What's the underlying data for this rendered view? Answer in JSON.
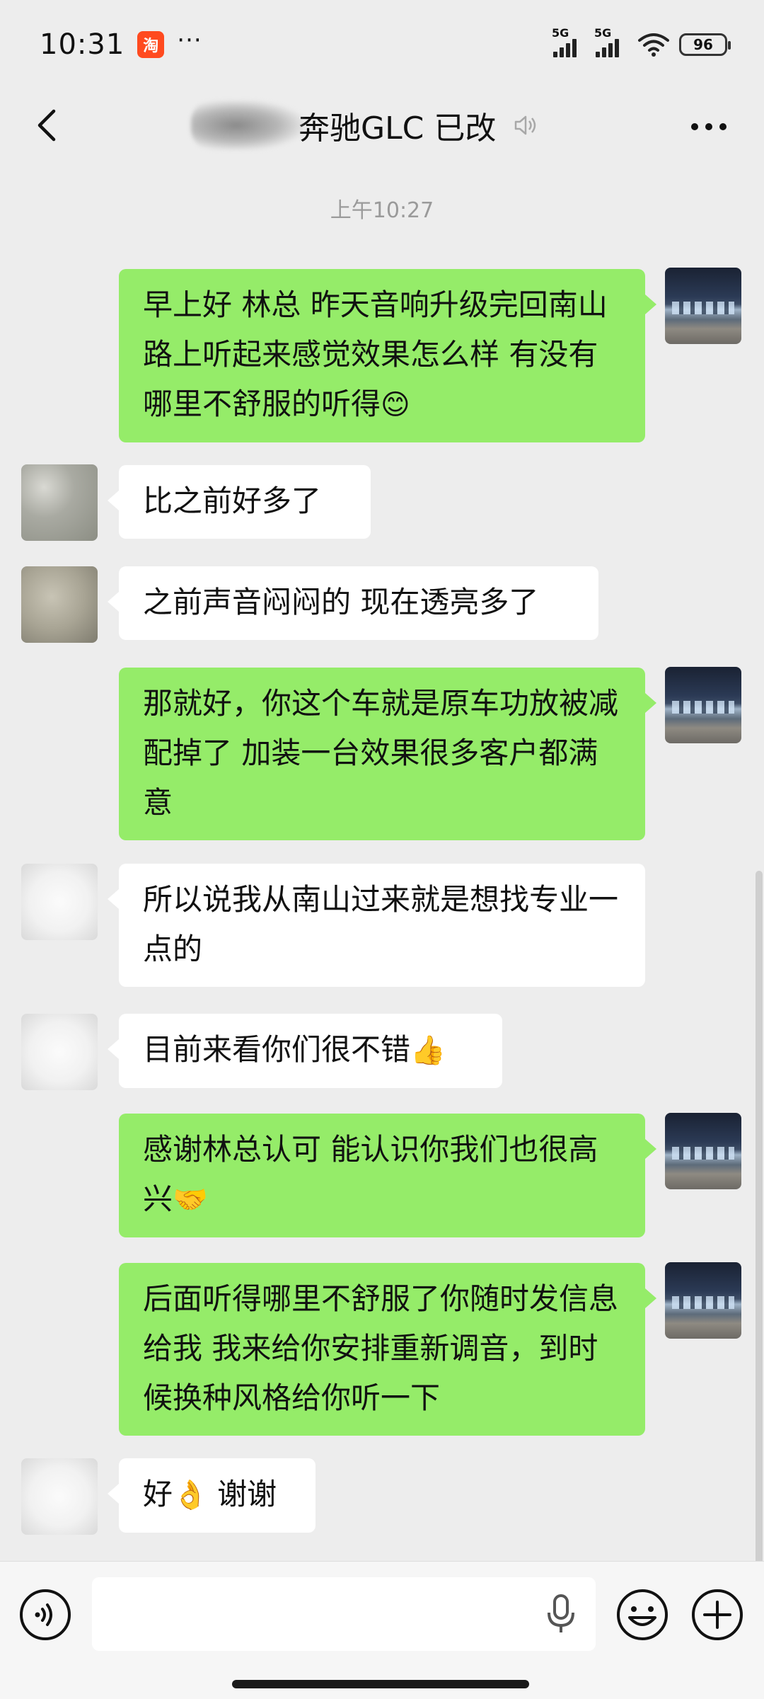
{
  "status_bar": {
    "time": "10:31",
    "app_badge": "淘",
    "dots": "···",
    "signal1_tag": "5G",
    "signal2_tag": "5G",
    "battery": "96"
  },
  "header": {
    "title": "奔驰GLC 已改"
  },
  "timestamp": "上午10:27",
  "messages": [
    {
      "from": "me",
      "text": "早上好 林总 昨天音响升级完回南山路上听起来感觉效果怎么样 有没有哪里不舒服的听得",
      "emoji": "😊"
    },
    {
      "from": "them",
      "text": "比之前好多了"
    },
    {
      "from": "them",
      "text": "之前声音闷闷的 现在透亮多了"
    },
    {
      "from": "me",
      "text": "那就好，你这个车就是原车功放被减配掉了 加装一台效果很多客户都满意"
    },
    {
      "from": "them",
      "text": "所以说我从南山过来就是想找专业一点的"
    },
    {
      "from": "them",
      "text": "目前来看你们很不错",
      "emoji": "👍"
    },
    {
      "from": "me",
      "text": "感谢林总认可 能认识你我们也很高兴",
      "emoji": "🤝"
    },
    {
      "from": "me",
      "text": "后面听得哪里不舒服了你随时发信息给我 我来给你安排重新调音，到时候换种风格给你听一下"
    },
    {
      "from": "them",
      "text": "好",
      "emoji": "👌",
      "text_after": " 谢谢"
    }
  ],
  "input": {
    "value": "",
    "placeholder": ""
  },
  "colors": {
    "my_bubble": "#95ec69",
    "their_bubble": "#ffffff",
    "background": "#ededed"
  }
}
